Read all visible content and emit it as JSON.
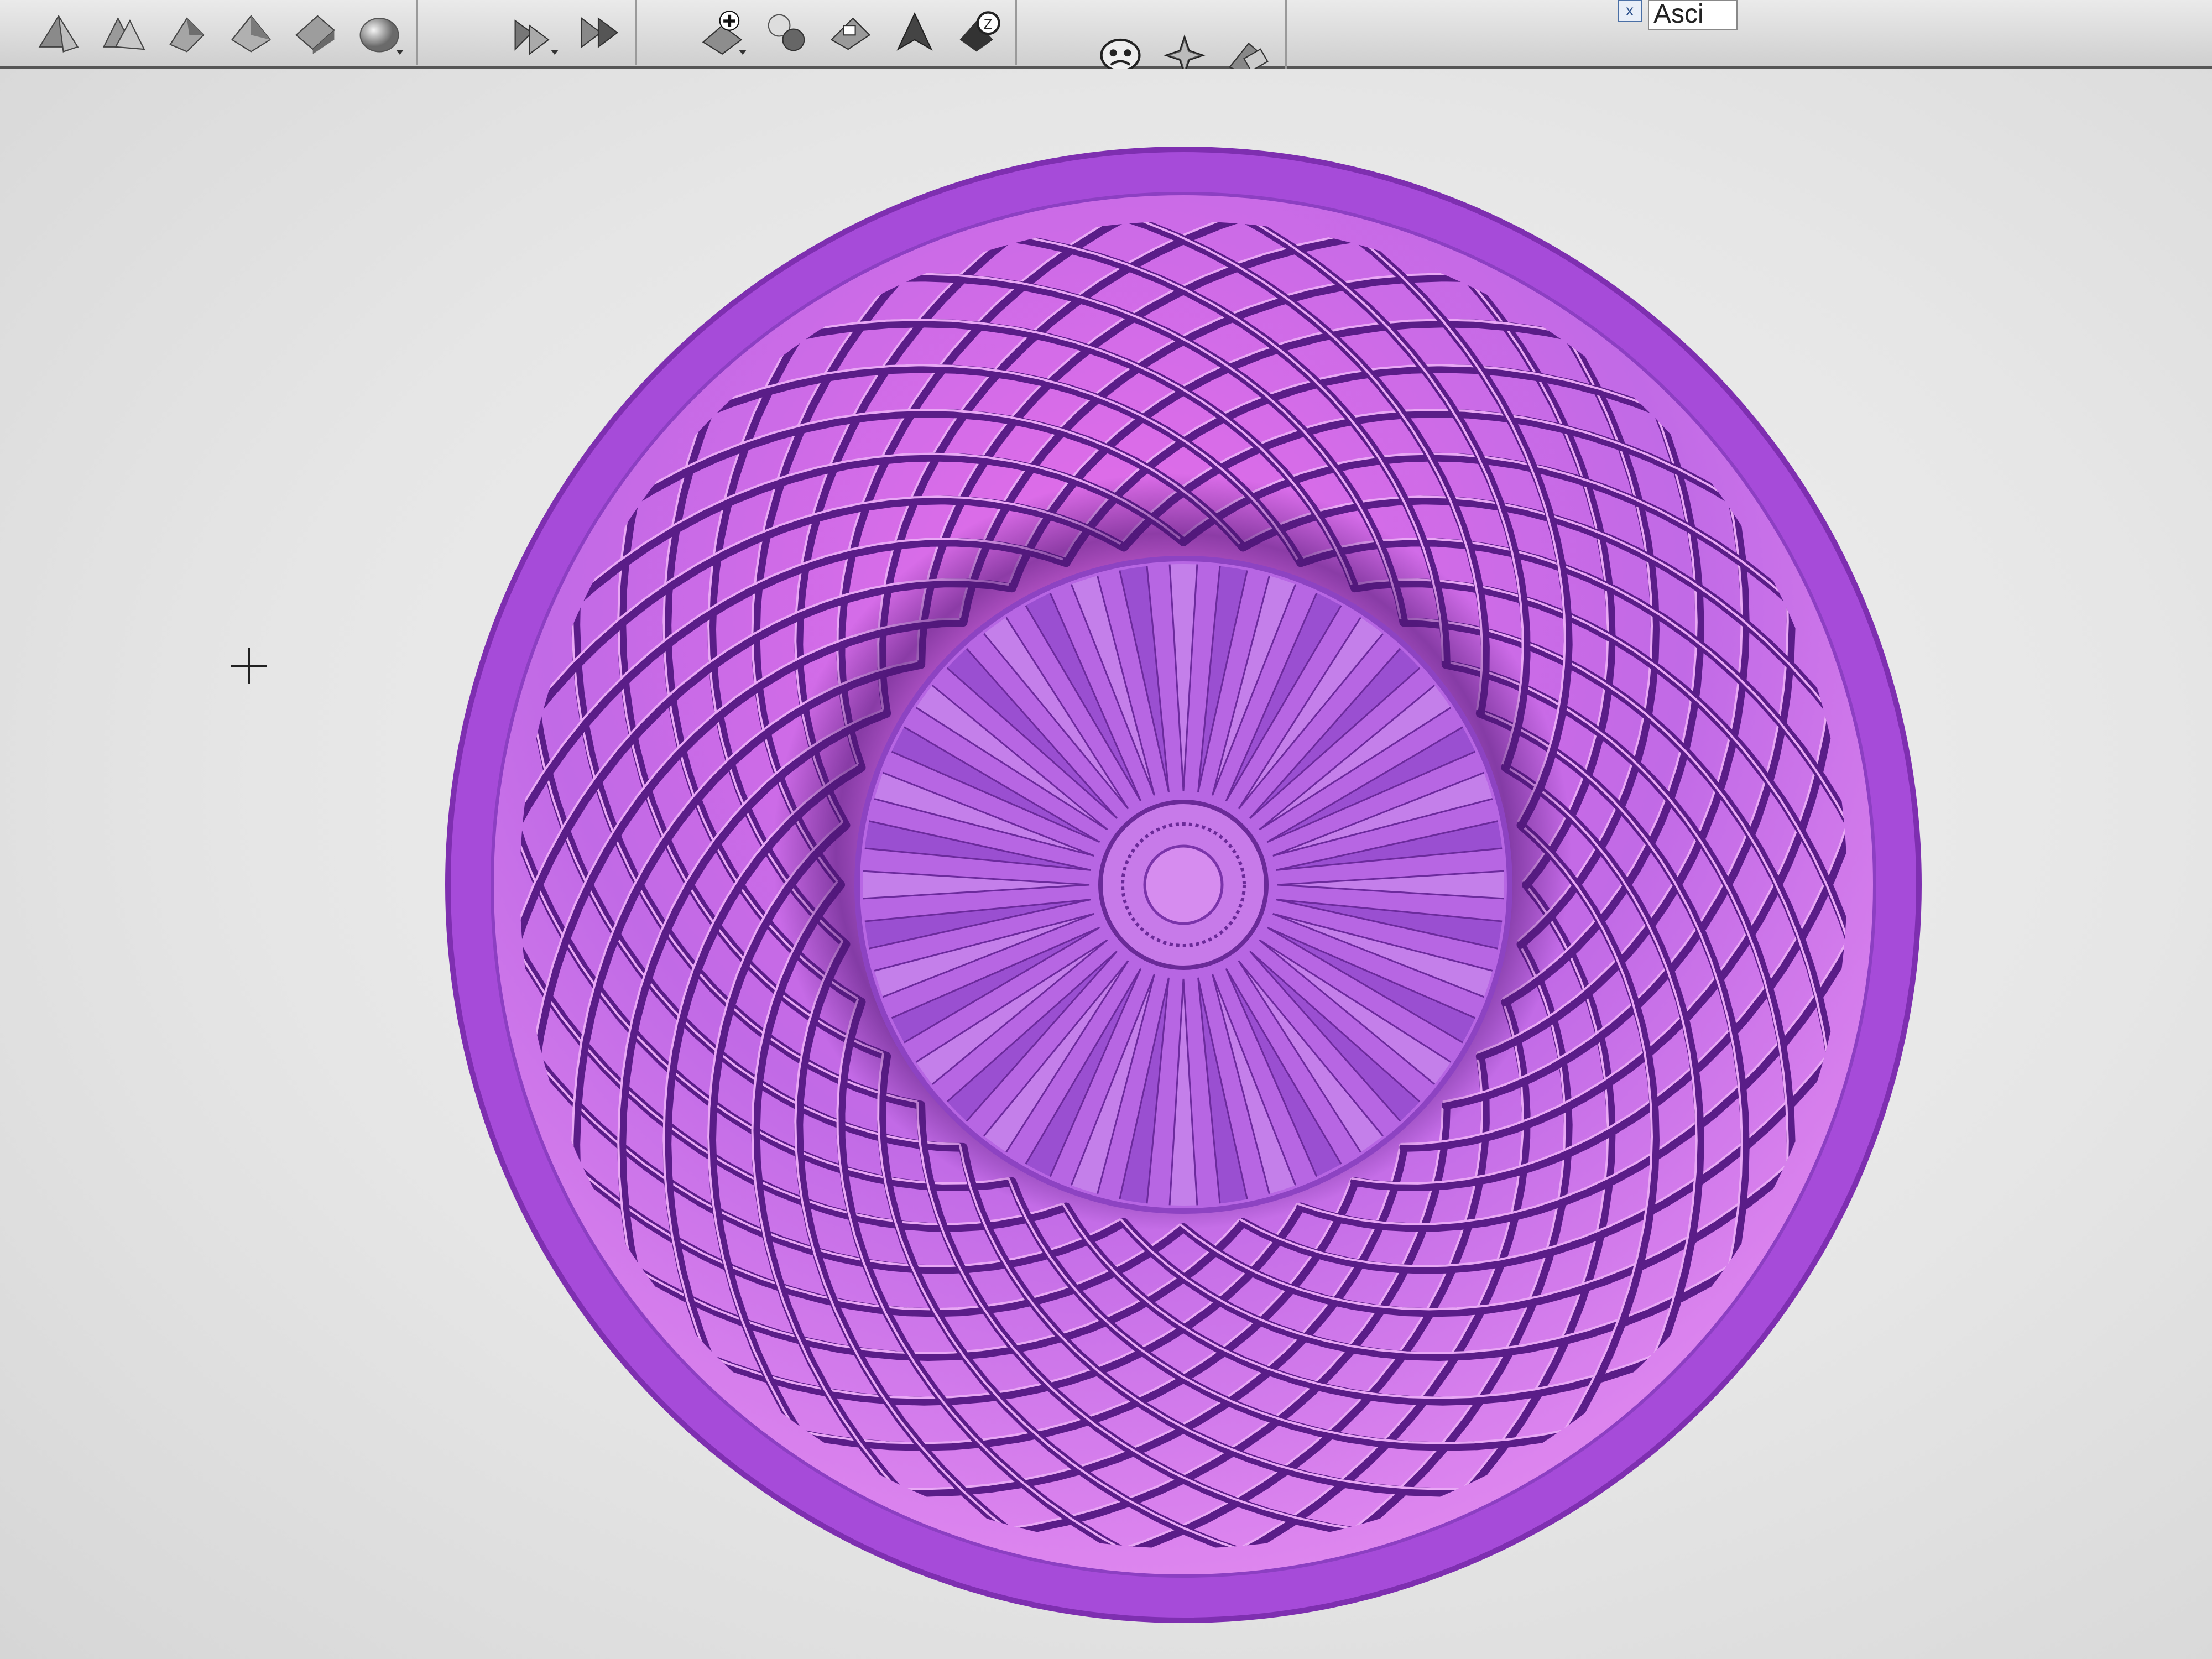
{
  "toolbar": {
    "groups": [
      {
        "name": "view-group",
        "icons": [
          "view-front-icon",
          "view-back-icon",
          "view-left-icon",
          "view-right-icon",
          "view-iso-icon",
          "render-sphere-icon"
        ]
      },
      {
        "name": "orient-group",
        "icons": [
          "orient-left-icon",
          "orient-right-icon"
        ]
      },
      {
        "name": "tools-group",
        "icons": [
          "add-relief-icon",
          "spheres-icon",
          "flatten-icon",
          "peak-icon",
          "zoom-icon"
        ]
      },
      {
        "name": "extra-group",
        "icons": [
          "mask-icon",
          "star-relief-icon",
          "eraser-icon"
        ]
      }
    ],
    "ascii_label": "Asci",
    "close_label": "x"
  },
  "viewport": {
    "model_colors": {
      "rim": "#a64bd9",
      "mid": "#c16ae6",
      "dark": "#4b1470",
      "light": "#e28af0",
      "hot": "#e46de9"
    }
  }
}
